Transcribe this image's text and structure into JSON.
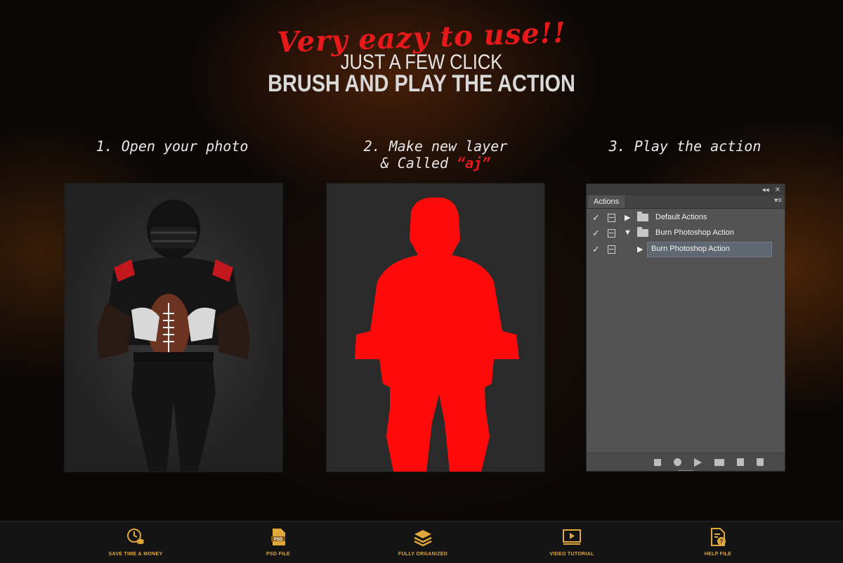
{
  "headline": {
    "script": "Very eazy to use!!",
    "line1": "JUST A FEW CLICK",
    "line2": "BRUSH AND PLAY THE ACTION"
  },
  "steps": [
    {
      "label": "1. Open your photo"
    },
    {
      "label_a": "2. Make new layer",
      "label_b": "& Called",
      "highlight": "“aj”"
    },
    {
      "label": "3. Play the action"
    }
  ],
  "actions_panel": {
    "tab": "Actions",
    "top_icons": [
      "◂◂",
      "✕"
    ],
    "rows": [
      {
        "name": "Default Actions",
        "expanded": false,
        "type": "set"
      },
      {
        "name": "Burn Photoshop Action",
        "expanded": true,
        "type": "set"
      },
      {
        "name": "Burn Photoshop Action",
        "expanded": false,
        "type": "action",
        "selected": true
      }
    ],
    "check": "✓",
    "bottom_icons": [
      "stop-icon",
      "record-icon",
      "play-icon",
      "folder-icon",
      "new-action-icon",
      "trash-icon"
    ]
  },
  "features": [
    {
      "label": "SAVE TIME & MONEY",
      "icon": "clock-coins-icon"
    },
    {
      "label": "PSD FILE",
      "icon": "psd-file-icon"
    },
    {
      "label": "FULLY ORGANIZED",
      "icon": "layers-icon"
    },
    {
      "label": "VIDEO TUTORIAL",
      "icon": "video-icon"
    },
    {
      "label": "HELP FILE",
      "icon": "help-file-icon"
    }
  ],
  "colors": {
    "accent_red": "#e8191b",
    "feature_gold": "#e0a83a",
    "panel_gray": "#535353"
  }
}
